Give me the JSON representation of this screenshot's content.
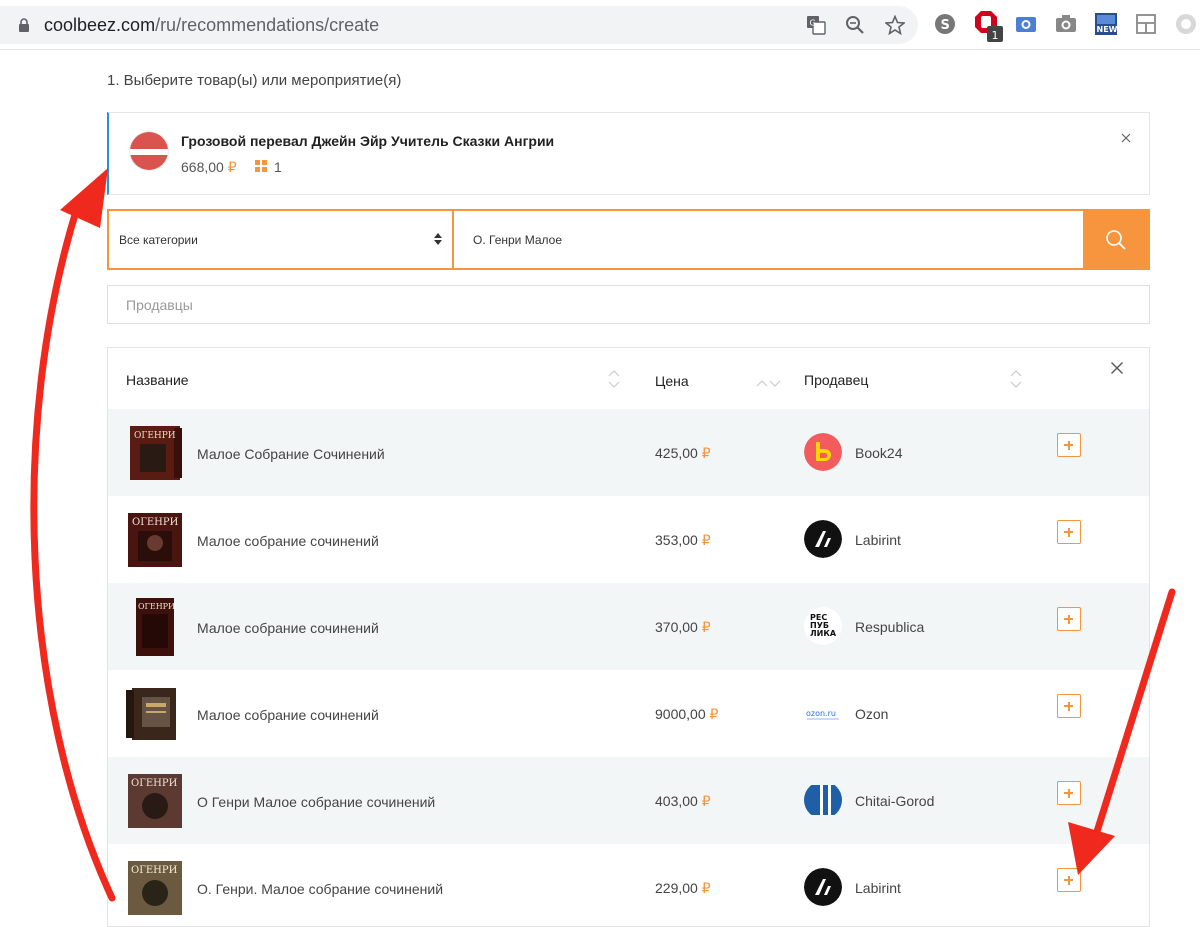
{
  "browser": {
    "url_host": "coolbeez.com",
    "url_path": "/ru/recommendations/create",
    "extension_badge": "1"
  },
  "page": {
    "step_title": "1. Выберите товар(ы) или мероприятие(я)",
    "selected_item": {
      "title": "Грозовой перевал Джейн Эйр Учитель Сказки Ангрии",
      "price": "668,00",
      "currency": "₽",
      "quantity": "1"
    },
    "search": {
      "category": "Все категории",
      "query": "О. Генри Малое"
    },
    "sellers_placeholder": "Продавцы",
    "table": {
      "columns": [
        "Название",
        "Цена",
        "Продавец"
      ],
      "rows": [
        {
          "name": "Малое Собрание Сочинений",
          "price": "425,00",
          "seller": "Book24",
          "logo": "book24-logo"
        },
        {
          "name": "Малое собрание сочинений",
          "price": "353,00",
          "seller": "Labirint",
          "logo": "labirint-logo"
        },
        {
          "name": "Малое собрание сочинений",
          "price": "370,00",
          "seller": "Respublica",
          "logo": "respublica-logo"
        },
        {
          "name": "Малое собрание сочинений",
          "price": "9000,00",
          "seller": "Ozon",
          "logo": "ozon-logo"
        },
        {
          "name": "О Генри Малое собрание сочинений",
          "price": "403,00",
          "seller": "Chitai-Gorod",
          "logo": "chitai-gorod-logo"
        },
        {
          "name": "О. Генри. Малое собрание сочинений",
          "price": "229,00",
          "seller": "Labirint",
          "logo": "labirint-logo"
        }
      ],
      "currency": "₽"
    }
  },
  "colors": {
    "accent": "#f7943e",
    "selected_border": "#2d8fd5",
    "annotation_arrow": "#f0291e"
  },
  "logo_text": {
    "respublica": [
      "РЕС",
      "ПУБ",
      "ЛИКА"
    ],
    "ozon": "ozon.ru"
  }
}
